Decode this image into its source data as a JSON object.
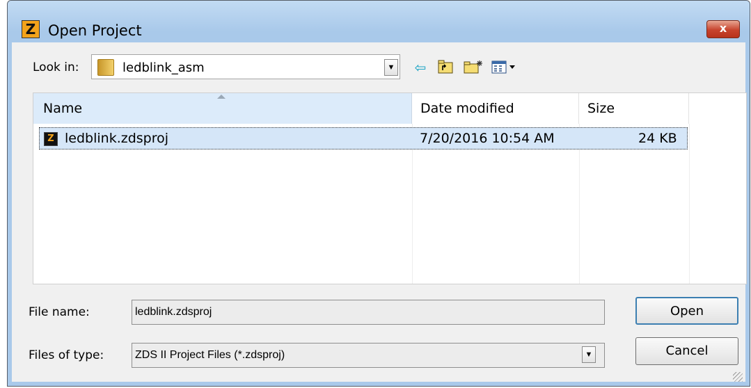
{
  "window": {
    "title": "Open Project",
    "app_icon_letter": "Z",
    "close_glyph": "x"
  },
  "look_in": {
    "label": "Look in:",
    "value": "ledblink_asm",
    "folder_icon": "folder-icon"
  },
  "toolbar": {
    "back_icon": "back-arrow-icon",
    "up_folder_icon": "up-folder-icon",
    "new_folder_icon": "new-folder-icon",
    "view_menu_icon": "view-menu-icon"
  },
  "file_list": {
    "columns": {
      "name": "Name",
      "date": "Date modified",
      "size": "Size"
    },
    "rows": [
      {
        "name": "ledblink.zdsproj",
        "date": "7/20/2016 10:54 AM",
        "size": "24 KB",
        "icon": "zds-project-icon"
      }
    ]
  },
  "file_name": {
    "label": "File name:",
    "value": "ledblink.zdsproj"
  },
  "file_type": {
    "label": "Files of type:",
    "value": "ZDS II Project Files (*.zdsproj)"
  },
  "buttons": {
    "open": "Open",
    "cancel": "Cancel"
  },
  "colors": {
    "title_bar": "#a9c9ea",
    "close_button": "#c7432d",
    "selection": "#d5e6f8",
    "client_bg": "#f0f0f0"
  }
}
